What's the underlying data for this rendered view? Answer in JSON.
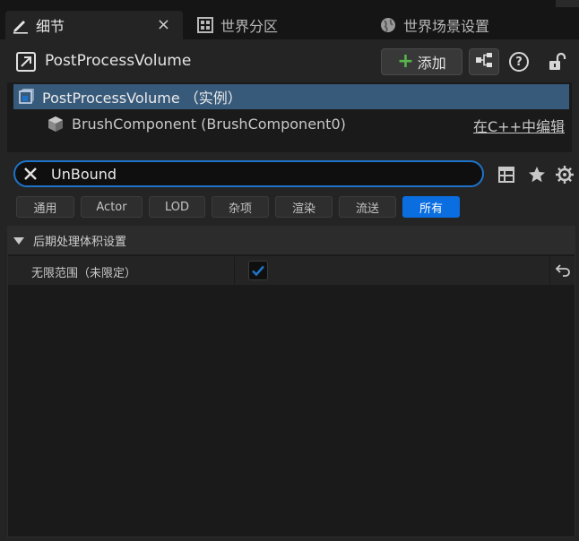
{
  "tabs": [
    {
      "label": "细节",
      "icon": "pencil-icon",
      "active": true,
      "close": "×"
    },
    {
      "label": "世界分区",
      "icon": "grid-icon",
      "active": false
    },
    {
      "label": "世界场景设置",
      "icon": "globe-icon",
      "active": false
    }
  ],
  "header": {
    "actor_name": "PostProcessVolume",
    "add_label": "添加",
    "add_plus": "+"
  },
  "tree": {
    "root_label": "PostProcessVolume （实例）",
    "child_label": "BrushComponent (BrushComponent0)",
    "edit_link": "在C++中编辑"
  },
  "search": {
    "value": "UnBound",
    "placeholder": ""
  },
  "filters": [
    {
      "label": "通用",
      "active": false
    },
    {
      "label": "Actor",
      "active": false
    },
    {
      "label": "LOD",
      "active": false
    },
    {
      "label": "杂项",
      "active": false
    },
    {
      "label": "渲染",
      "active": false
    },
    {
      "label": "流送",
      "active": false
    },
    {
      "label": "所有",
      "active": true
    }
  ],
  "category": {
    "label": "后期处理体积设置"
  },
  "property": {
    "name": "无限范围（未限定）",
    "checked": true
  },
  "colors": {
    "accent": "#0a6ee0",
    "selection": "#385a7a",
    "add_green": "#55b54a",
    "search_border": "#1e73c8"
  }
}
